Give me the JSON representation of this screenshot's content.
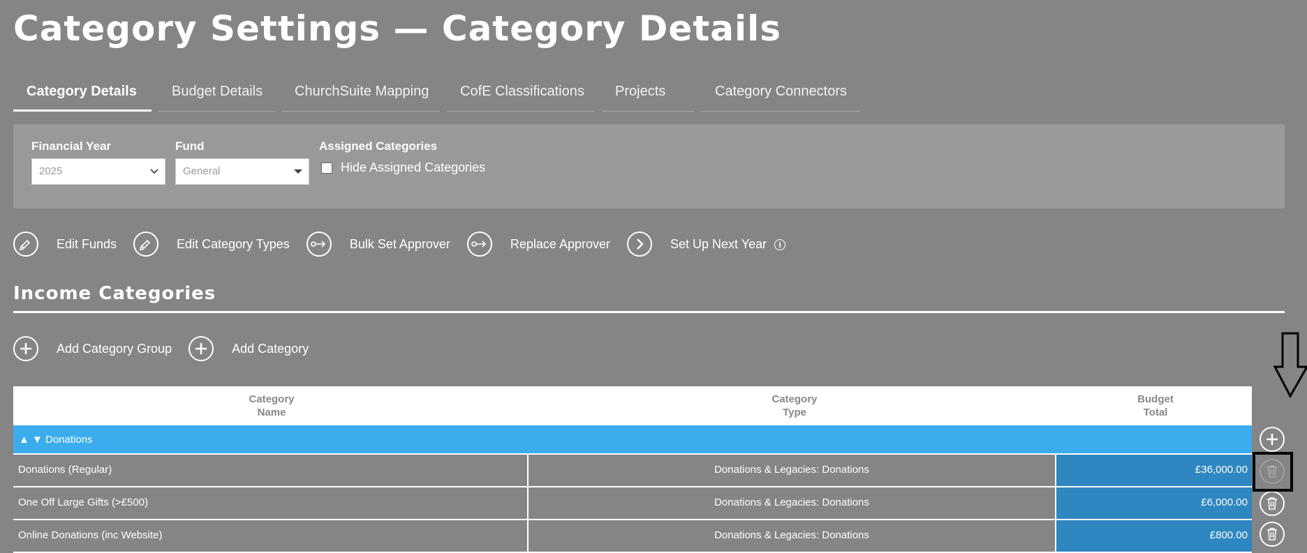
{
  "page": {
    "title": "Category Settings — Category Details"
  },
  "tabs": [
    {
      "label": "Category Details",
      "active": true
    },
    {
      "label": "Budget Details",
      "active": false
    },
    {
      "label": "ChurchSuite Mapping",
      "active": false
    },
    {
      "label": "CofE Classifications",
      "active": false
    },
    {
      "label": "Projects",
      "active": false
    },
    {
      "label": "Category Connectors",
      "active": false
    }
  ],
  "filters": {
    "financial_year": {
      "label": "Financial Year",
      "value": "2025"
    },
    "fund": {
      "label": "Fund",
      "value": "General"
    },
    "assigned": {
      "label": "Assigned Categories",
      "checkbox_label": "Hide Assigned Categories",
      "checked": false
    }
  },
  "toolbar": {
    "edit_funds": "Edit Funds",
    "edit_category_types": "Edit Category Types",
    "bulk_set_approver": "Bulk Set Approver",
    "replace_approver": "Replace Approver",
    "set_up_next_year": "Set Up Next Year"
  },
  "income": {
    "section_title": "Income Categories",
    "add_group": "Add Category Group",
    "add_category": "Add Category",
    "columns": {
      "name_line1": "Category",
      "name_line2": "Name",
      "type_line1": "Category",
      "type_line2": "Type",
      "budget_line1": "Budget",
      "budget_line2": "Total"
    },
    "group": {
      "arrows": "▲ ▼",
      "name": "Donations"
    },
    "rows": [
      {
        "name": "Donations (Regular)",
        "type": "Donations & Legacies: Donations",
        "budget": "£36,000.00"
      },
      {
        "name": "One Off Large Gifts (>£500)",
        "type": "Donations & Legacies: Donations",
        "budget": "£6,000.00"
      },
      {
        "name": "Online Donations (inc Website)",
        "type": "Donations & Legacies: Donations",
        "budget": "£800.00"
      }
    ]
  },
  "colors": {
    "background": "#858585",
    "panel": "#999999",
    "group_row": "#3bacee",
    "budget_cell": "#2e87c0"
  }
}
